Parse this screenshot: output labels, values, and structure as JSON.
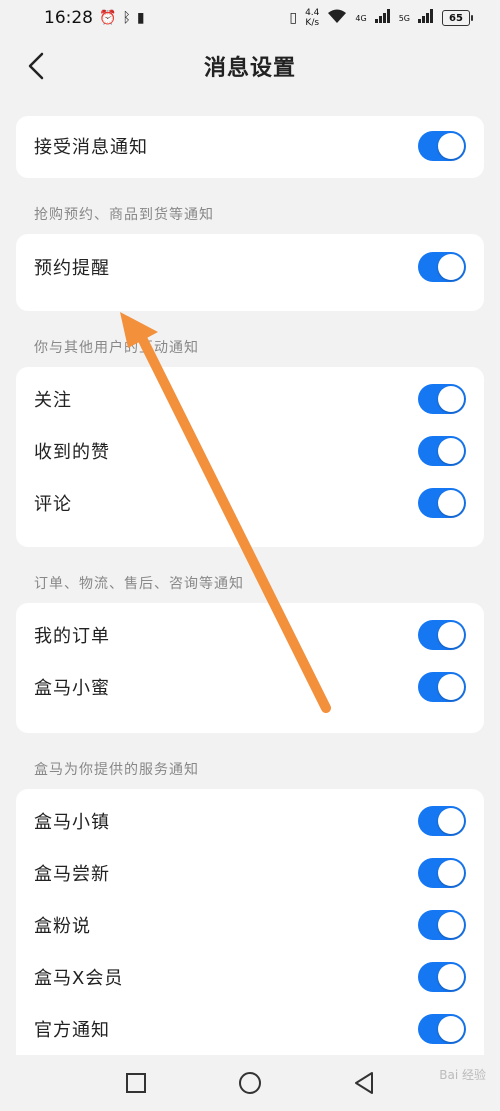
{
  "status_bar": {
    "time": "16:28",
    "speed_top": "4.4",
    "speed_bottom": "K/s",
    "net1": "4G",
    "net2": "5G",
    "battery": "65"
  },
  "header": {
    "title": "消息设置"
  },
  "sections": [
    {
      "label": "",
      "items": [
        {
          "label": "接受消息通知",
          "on": true
        }
      ]
    },
    {
      "label": "抢购预约、商品到货等通知",
      "items": [
        {
          "label": "预约提醒",
          "on": true
        }
      ]
    },
    {
      "label": "你与其他用户的互动通知",
      "items": [
        {
          "label": "关注",
          "on": true
        },
        {
          "label": "收到的赞",
          "on": true
        },
        {
          "label": "评论",
          "on": true
        }
      ]
    },
    {
      "label": "订单、物流、售后、咨询等通知",
      "items": [
        {
          "label": "我的订单",
          "on": true
        },
        {
          "label": "盒马小蜜",
          "on": true
        }
      ]
    },
    {
      "label": "盒马为你提供的服务通知",
      "items": [
        {
          "label": "盒马小镇",
          "on": true
        },
        {
          "label": "盒马尝新",
          "on": true
        },
        {
          "label": "盒粉说",
          "on": true
        },
        {
          "label": "盒马X会员",
          "on": true
        },
        {
          "label": "官方通知",
          "on": true
        }
      ]
    }
  ],
  "colors": {
    "toggle_on": "#1677f2",
    "annotation_arrow": "#f2903c"
  },
  "watermark": "Bai 经验"
}
